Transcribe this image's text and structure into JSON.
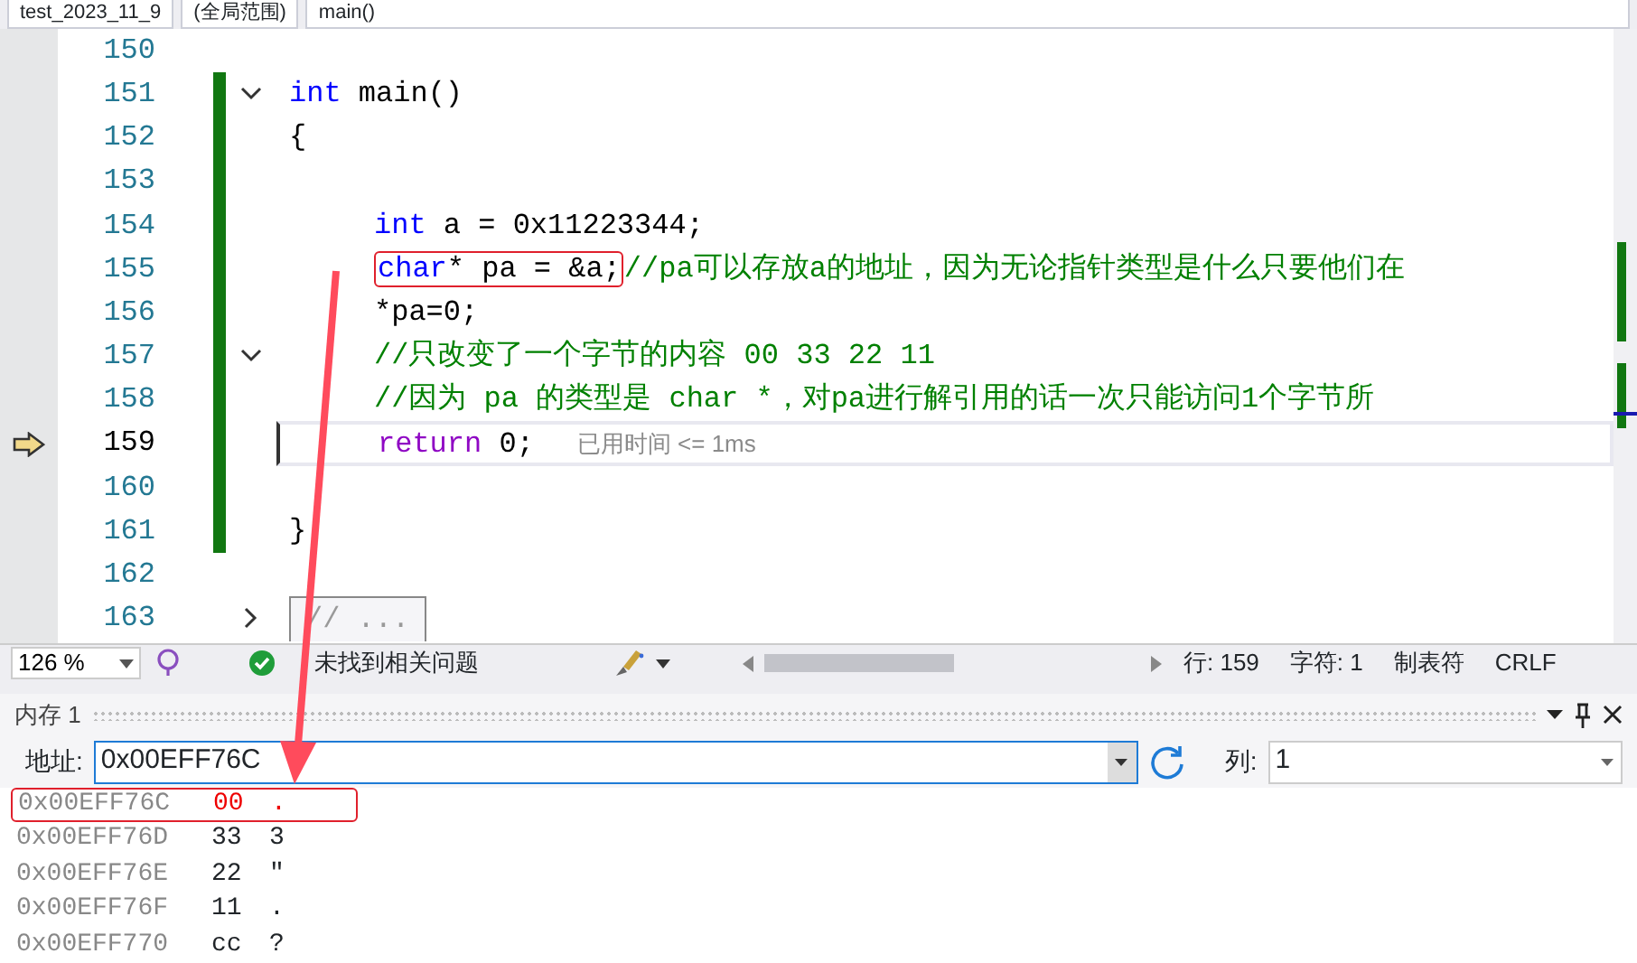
{
  "navigation_bar": {
    "project": "test_2023_11_9",
    "scope": "(全局范围)",
    "member": "main()"
  },
  "lines": [
    {
      "number": "150",
      "current": false,
      "changed": false
    },
    {
      "number": "151",
      "current": false,
      "changed": true,
      "indented": false,
      "fold_expanded": true,
      "tokens": [
        {
          "kind": "keyword",
          "text": "int"
        },
        {
          "kind": "plain",
          "text": " main()"
        }
      ]
    },
    {
      "number": "152",
      "current": false,
      "changed": true,
      "indented": false,
      "tokens": [
        {
          "kind": "plain",
          "text": "{"
        }
      ]
    },
    {
      "number": "153",
      "current": false,
      "changed": true
    },
    {
      "number": "154",
      "current": false,
      "changed": true,
      "indented": true,
      "tokens": [
        {
          "kind": "keyword",
          "text": "int"
        },
        {
          "kind": "plain",
          "text": " a = 0x11223344;"
        }
      ]
    },
    {
      "number": "155",
      "current": false,
      "changed": true,
      "indented": true,
      "tokens": [
        {
          "kind": "keyword",
          "text": "char",
          "boxed": true
        },
        {
          "kind": "plain",
          "text": "* pa = &a;",
          "boxed": true
        },
        {
          "kind": "comment",
          "text": "//pa可以存放a的地址，因为无论指针类型是什么只要他们在",
          "boxed": false
        }
      ]
    },
    {
      "number": "156",
      "current": false,
      "changed": true,
      "indented": true,
      "tokens": [
        {
          "kind": "plain",
          "text": "*pa=0;"
        }
      ]
    },
    {
      "number": "157",
      "current": false,
      "changed": true,
      "indented": true,
      "fold_expanded": true,
      "tokens": [
        {
          "kind": "comment",
          "text": "//只改变了一个字节的内容 00 33 22 11"
        }
      ]
    },
    {
      "number": "158",
      "current": false,
      "changed": true,
      "indented": true,
      "tokens": [
        {
          "kind": "comment",
          "text": "//因为 pa 的类型是 char *，对pa进行解引用的话一次只能访问1个字节所"
        }
      ]
    },
    {
      "number": "159",
      "current": true,
      "changed": true,
      "indented": true,
      "tokens": [
        {
          "kind": "control",
          "text": "return"
        },
        {
          "kind": "plain",
          "text": " 0;"
        }
      ],
      "hint": "已用时间 <= 1ms"
    },
    {
      "number": "160",
      "current": false,
      "changed": true
    },
    {
      "number": "161",
      "current": false,
      "changed": true,
      "indented": false,
      "tokens": [
        {
          "kind": "plain",
          "text": "}"
        }
      ]
    },
    {
      "number": "162",
      "current": false,
      "changed": false
    },
    {
      "number": "163",
      "current": false,
      "changed": false,
      "fold_expanded": false,
      "collapsed_text": "// ..."
    }
  ],
  "status_bar": {
    "zoom": "126 %",
    "issues": "未找到相关问题",
    "line": "行: 159",
    "char": "字符: 1",
    "indent": "制表符",
    "line_ending": "CRLF"
  },
  "memory": {
    "title": "内存 1",
    "address_label": "地址:",
    "address": "0x00EFF76C",
    "columns_label": "列:",
    "columns": "1",
    "rows": [
      {
        "address": "0x00EFF76C",
        "value": "00",
        "char": ".",
        "changed": true,
        "boxed": true
      },
      {
        "address": "0x00EFF76D",
        "value": "33",
        "char": "3",
        "changed": false,
        "boxed": false
      },
      {
        "address": "0x00EFF76E",
        "value": "22",
        "char": "\"",
        "changed": false,
        "boxed": false
      },
      {
        "address": "0x00EFF76F",
        "value": "11",
        "char": ".",
        "changed": false,
        "boxed": false
      },
      {
        "address": "0x00EFF770",
        "value": "cc",
        "char": "?",
        "changed": false,
        "boxed": false
      }
    ]
  }
}
